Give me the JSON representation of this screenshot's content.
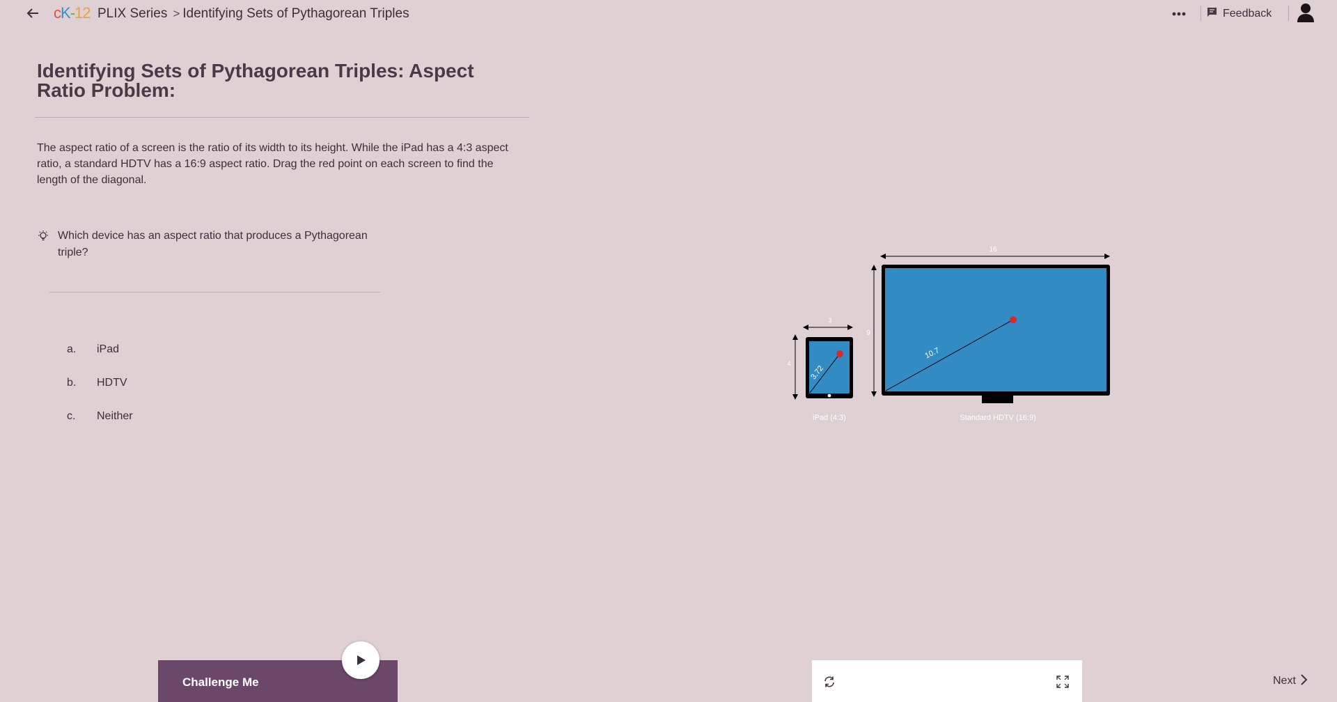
{
  "header": {
    "logo_text": "cK-12",
    "breadcrumb_root": "PLIX Series",
    "breadcrumb_separator": ">",
    "breadcrumb_current": "Identifying Sets of Pythagorean Triples",
    "feedback_label": "Feedback"
  },
  "main": {
    "title": "Identifying Sets of Pythagorean Triples: Aspect Ratio Problem:",
    "description": "The aspect ratio of a screen is the ratio of its width to its height. While the iPad has a 4:3 aspect ratio, a standard HDTV has a 16:9 aspect ratio. Drag the red point on each screen to find the length of the diagonal.",
    "question": "Which device has an aspect ratio that produces a Pythagorean triple?",
    "options": [
      {
        "letter": "a.",
        "label": "iPad"
      },
      {
        "letter": "b.",
        "label": "HDTV"
      },
      {
        "letter": "c.",
        "label": "Neither"
      }
    ]
  },
  "diagram": {
    "ipad": {
      "width_label": "3",
      "height_label": "4",
      "diagonal_label": "3.72",
      "caption": "iPad (4:3)"
    },
    "hdtv": {
      "width_label": "16",
      "height_label": "9",
      "diagonal_label": "10.7",
      "caption": "Standard HDTV (16:9)"
    },
    "colors": {
      "screen": "#338bc4",
      "frame": "#000000",
      "handle": "#d62b2b",
      "label": "#ffffff"
    }
  },
  "footer": {
    "challenge_label": "Challenge Me",
    "next_label": "Next"
  }
}
